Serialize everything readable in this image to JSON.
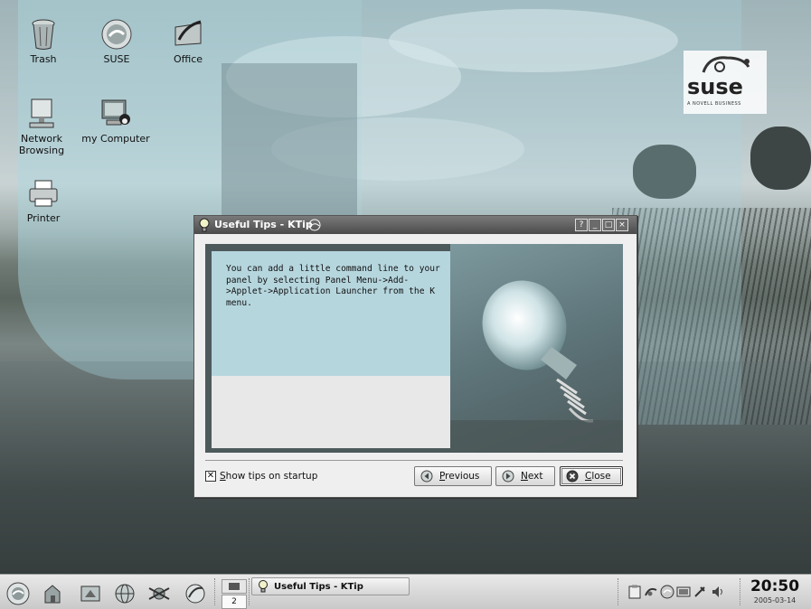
{
  "desktop": {
    "icons": [
      {
        "label": "Trash",
        "icon": "trash-icon"
      },
      {
        "label": "SUSE",
        "icon": "suse-icon"
      },
      {
        "label": "Office",
        "icon": "office-icon"
      },
      {
        "label": "Network Browsing",
        "icon": "network-icon"
      },
      {
        "label": "my Computer",
        "icon": "computer-icon"
      },
      {
        "label": "Printer",
        "icon": "printer-icon"
      }
    ],
    "brand": {
      "name": "suse",
      "tagline": "A NOVELL BUSINESS"
    }
  },
  "dialog": {
    "title": "Useful Tips - KTip",
    "title_buttons": [
      "?",
      "_",
      "□",
      "×"
    ],
    "tip_text": "You can add a little command line to your panel by selecting Panel Menu->Add->Applet->Application Launcher from the K menu.",
    "show_tips": {
      "label_prefix": "S",
      "label_rest": "how tips on startup",
      "checked": true
    },
    "buttons": {
      "previous": {
        "prefix": "P",
        "rest": "revious"
      },
      "next": {
        "prefix": "N",
        "rest": "ext"
      },
      "close": {
        "prefix": "C",
        "rest": "lose"
      }
    }
  },
  "taskbar": {
    "pager": {
      "desktop1": "",
      "desktop2": "2"
    },
    "task": {
      "label": "Useful Tips - KTip"
    },
    "clock": {
      "time": "20:50",
      "date": "2005-03-14"
    }
  },
  "colors": {
    "accent": "#b6d6de",
    "titlebar": "#5a5a5a"
  }
}
